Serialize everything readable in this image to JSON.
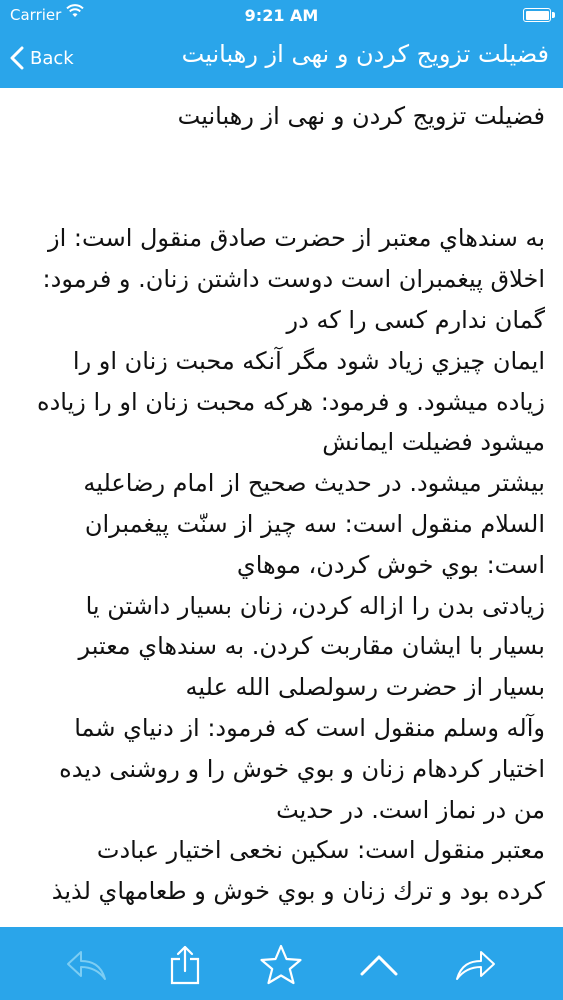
{
  "status_bar": {
    "carrier": "Carrier",
    "time": "9:21 AM"
  },
  "nav": {
    "back_label": "Back",
    "title": "فضیلت تزویج کردن و نهی از رهبانیت"
  },
  "content": {
    "lines": [
      "فضیلت تزویج کردن و نهی از رهبانیت",
      "",
      "",
      "به سندهاي معتبر از حضرت صادق منقول است: از",
      "اخلاق پیغمبران است دوست داشتن زنان. و فرمود:",
      "گمان ندارم کسی را که در",
      "ایمان چیزي زیاد شود مگر آنکه محبت زنان او را",
      "زیاده میشود. و فرمود: هرکه محبت زنان او را زیاده",
      "میشود فضیلت ایمانش",
      "بیشتر میشود. در حدیث صحیح از امام رضاعلیه",
      "السلام منقول است: سه چیز از سنّت پیغمبران",
      "است: بوي خوش کردن، موهاي",
      "زیادتی بدن را ازاله کردن، زنان بسیار داشتن یا",
      "بسیار با ایشان مقاربت کردن. به سندهاي معتبر",
      "بسیار از حضرت رسولصلی الله علیه",
      "وآله وسلم منقول است که فرمود: از دنیاي شما",
      "اختیار کردهام زنان و بوي خوش را و روشنی دیده",
      "من در نماز است. در حدیث",
      "معتبر منقول است: سکین نخعی اختیار عبادت",
      "کرده بود و ترك زنان و بوي خوش و طعامهاي لذیذ"
    ]
  },
  "toolbar": {
    "buttons": [
      {
        "icon": "reply-icon",
        "enabled": false
      },
      {
        "icon": "share-icon",
        "enabled": true
      },
      {
        "icon": "star-icon",
        "enabled": true
      },
      {
        "icon": "chevron-up-icon",
        "enabled": true
      },
      {
        "icon": "forward-icon",
        "enabled": true
      }
    ]
  },
  "colors": {
    "accent": "#2aa5ea",
    "text": "#111111",
    "background": "#ffffff"
  }
}
